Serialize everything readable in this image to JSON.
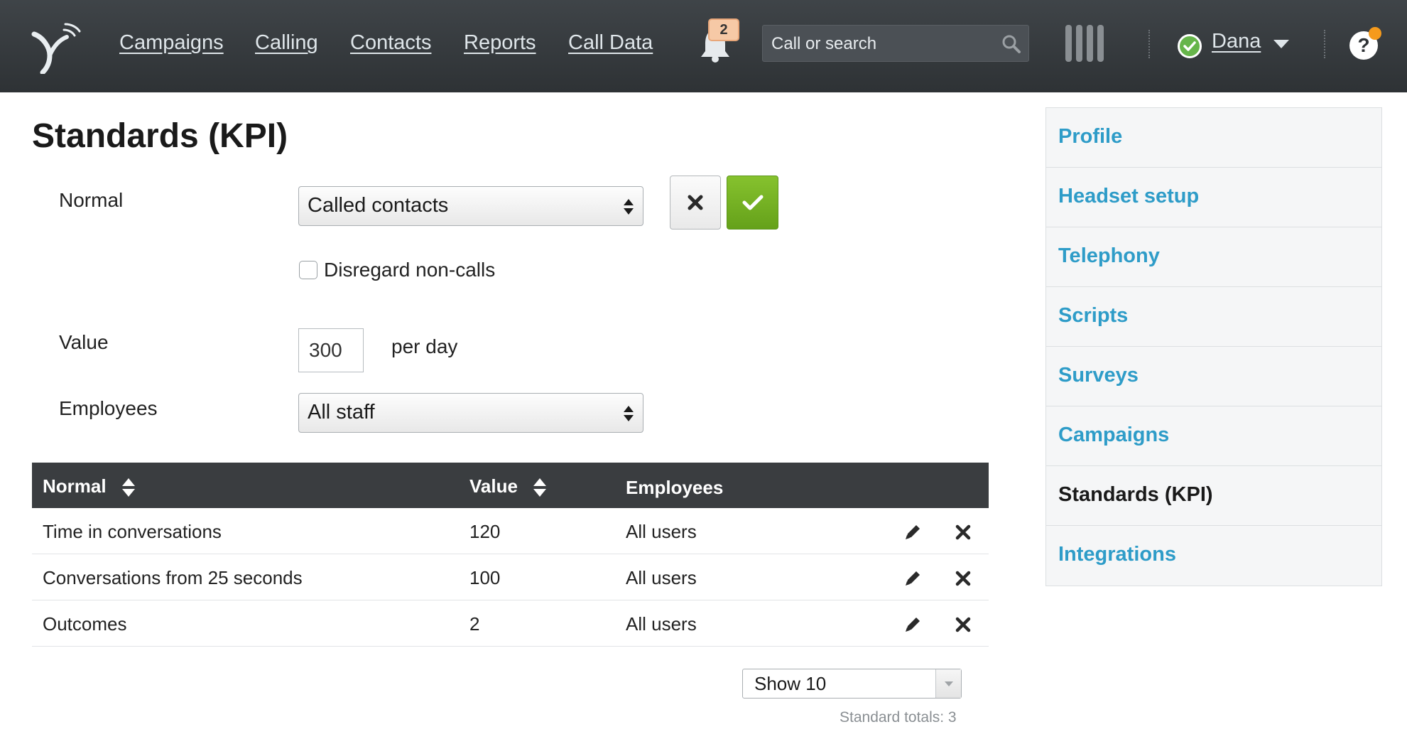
{
  "nav": {
    "links": [
      "Campaigns",
      "Calling",
      "Contacts",
      "Reports",
      "Call Data"
    ],
    "notification_count": "2",
    "search_placeholder": "Call or search",
    "user_name": "Dana",
    "help_label": "?"
  },
  "page": {
    "title": "Standards (KPI)"
  },
  "form": {
    "normal_label": "Normal",
    "normal_value": "Called contacts",
    "disregard_label": "Disregard non-calls",
    "value_label": "Value",
    "value": "300",
    "value_unit": "per day",
    "employees_label": "Employees",
    "employees_value": "All staff"
  },
  "table": {
    "headers": {
      "normal": "Normal",
      "value": "Value",
      "employees": "Employees"
    },
    "rows": [
      {
        "normal": "Time in conversations",
        "value": "120",
        "employees": "All users"
      },
      {
        "normal": "Conversations from 25 seconds",
        "value": "100",
        "employees": "All users"
      },
      {
        "normal": "Outcomes",
        "value": "2",
        "employees": "All users"
      }
    ],
    "page_size": "Show 10",
    "totals": "Standard totals: 3"
  },
  "sidebar": {
    "items": [
      {
        "label": "Profile",
        "active": false
      },
      {
        "label": "Headset setup",
        "active": false
      },
      {
        "label": "Telephony",
        "active": false
      },
      {
        "label": "Scripts",
        "active": false
      },
      {
        "label": "Surveys",
        "active": false
      },
      {
        "label": "Campaigns",
        "active": false
      },
      {
        "label": "Standards (KPI)",
        "active": true
      },
      {
        "label": "Integrations",
        "active": false
      }
    ]
  },
  "colors": {
    "topbar": "#33373a",
    "link_blue": "#2e9cc8",
    "confirm_green": "#76b226",
    "status_green": "#66b54a",
    "help_dot": "#f59a1c"
  },
  "icons": [
    "logo-icon",
    "bell-icon",
    "search-icon",
    "phone-lines-icon",
    "status-ok-icon",
    "caret-down-icon",
    "help-icon",
    "sort-icon",
    "pencil-icon",
    "close-icon",
    "check-icon"
  ]
}
